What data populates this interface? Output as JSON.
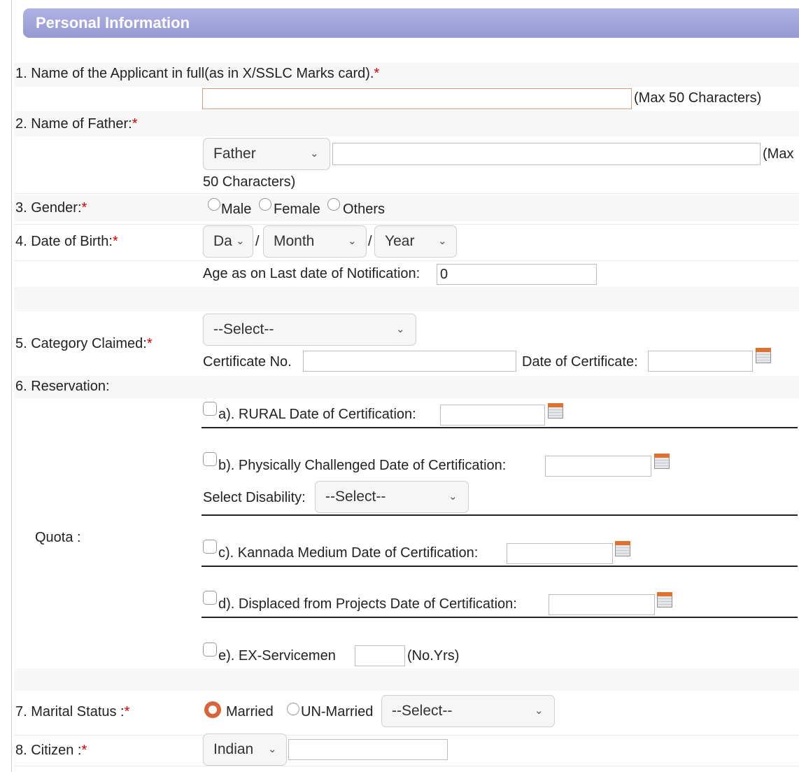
{
  "section_title": "Personal Information",
  "req_mark": "*",
  "q1": {
    "label": "1. Name of the Applicant in full(as in X/SSLC Marks card).",
    "value": "",
    "hint": "(Max 50 Characters)"
  },
  "q2": {
    "label": "2. Name of Father:",
    "relation_select": "Father",
    "value": "",
    "hint_line1": "(Max",
    "hint_line2": "50 Characters)"
  },
  "q3": {
    "label": "3. Gender:",
    "options": [
      "Male",
      "Female",
      "Others"
    ],
    "selected": null
  },
  "q4": {
    "label": "4. Date of Birth:",
    "day_select": "Da",
    "month_select": "Month",
    "year_select": "Year",
    "sep": "/",
    "age_label": "Age as on Last date of Notification:",
    "age_value": "0"
  },
  "q5": {
    "label": "5. Category Claimed:",
    "category_select": "--Select--",
    "cert_no_label": "Certificate No.",
    "cert_no_value": "",
    "cert_date_label": "Date of Certificate:",
    "cert_date_value": ""
  },
  "q6": {
    "label": "6. Reservation:",
    "quota_label": "Quota :",
    "items": {
      "a": {
        "label": "a). RURAL  Date of Certification:",
        "checked": false,
        "date": ""
      },
      "b": {
        "label": "b). Physically Challenged   Date of Certification:",
        "checked": false,
        "date": "",
        "disability_label": "Select Disability:",
        "disability_select": "--Select--"
      },
      "c": {
        "label": "c). Kannada Medium  Date of Certification:",
        "checked": false,
        "date": ""
      },
      "d": {
        "label": "d). Displaced from Projects  Date of Certification:",
        "checked": false,
        "date": ""
      },
      "e": {
        "label": "e). EX-Servicemen",
        "checked": false,
        "years_value": "",
        "years_label": "(No.Yrs)"
      }
    }
  },
  "q7": {
    "label": "7. Marital Status :",
    "options": [
      "Married",
      "UN-Married"
    ],
    "selected": "Married",
    "status_select": "--Select--"
  },
  "q8": {
    "label": "8. Citizen :",
    "citizen_select": "Indian",
    "value": ""
  },
  "colors": {
    "header": "#9da1dc",
    "radio_selected": "#d9633b",
    "required": "#dd0000"
  },
  "icons": {
    "dropdown": "chevron-down-icon",
    "calendar": "calendar-icon"
  }
}
